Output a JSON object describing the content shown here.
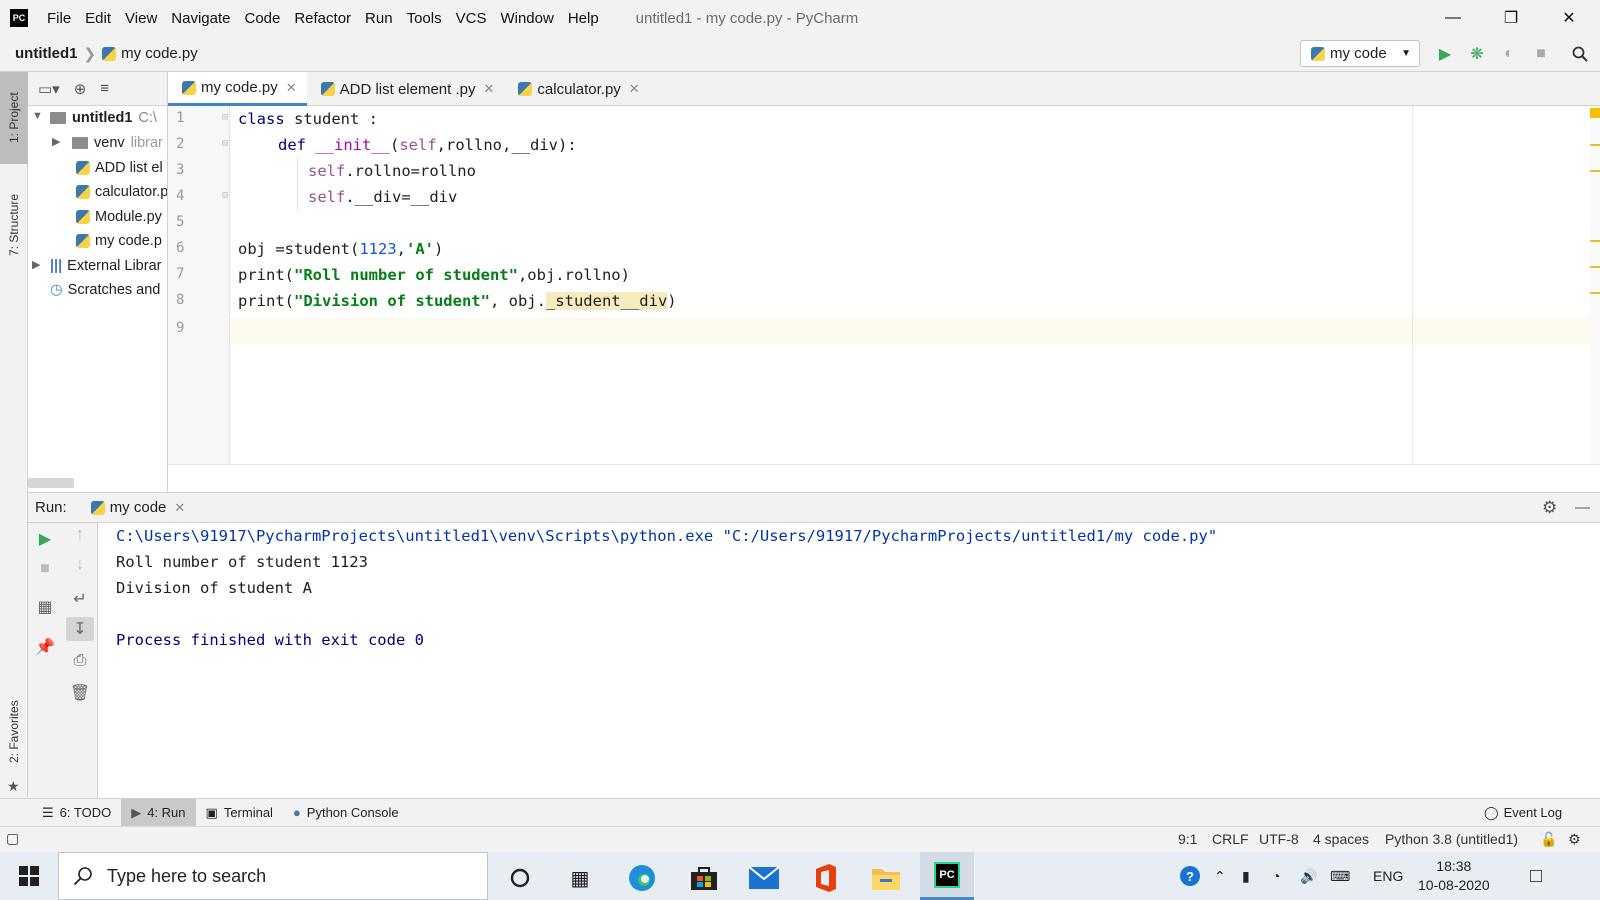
{
  "window": {
    "title": "untitled1 - my code.py - PyCharm",
    "menu": [
      "File",
      "Edit",
      "View",
      "Navigate",
      "Code",
      "Refactor",
      "Run",
      "Tools",
      "VCS",
      "Window",
      "Help"
    ]
  },
  "breadcrumb": {
    "project": "untitled1",
    "file": "my code.py"
  },
  "run_config": {
    "label": "my code"
  },
  "left_stripe": {
    "project": "1: Project",
    "structure": "7: Structure",
    "favorites": "2: Favorites"
  },
  "project_tree": {
    "root": "untitled1",
    "root_path": "C:\\",
    "items": [
      {
        "label": "venv",
        "suffix": "librar"
      },
      {
        "label": "ADD list el"
      },
      {
        "label": "calculator.p"
      },
      {
        "label": "Module.py"
      },
      {
        "label": "my code.p"
      },
      {
        "label": "External Librar"
      },
      {
        "label": "Scratches and"
      }
    ]
  },
  "editor_tabs": [
    {
      "label": "my code.py",
      "active": true
    },
    {
      "label": "ADD list element .py",
      "active": false
    },
    {
      "label": "calculator.py",
      "active": false
    }
  ],
  "code": {
    "line_numbers": [
      "1",
      "2",
      "3",
      "4",
      "5",
      "6",
      "7",
      "8",
      "9"
    ],
    "lines": {
      "l1_kw": "class",
      "l1_rest": " student :",
      "l2_kw": "def",
      "l2_name": " __init__",
      "l2_open": "(",
      "l2_self": "self",
      "l2_rest": ",rollno,__div):",
      "l3_self": "self",
      "l3_rest": ".rollno=rollno",
      "l4_self": "self",
      "l4_rest": ".__div=__div",
      "l6_a": "obj =student(",
      "l6_num": "1123",
      "l6_b": ",",
      "l6_str": "'A'",
      "l6_c": ")",
      "l7_a": "print(",
      "l7_str": "\"Roll number of student\"",
      "l7_b": ",obj.rollno)",
      "l8_a": "print(",
      "l8_str": "\"Division of student\"",
      "l8_b": ", obj.",
      "l8_hl": "_student__div",
      "l8_c": ")"
    }
  },
  "run_panel": {
    "label": "Run:",
    "tab": "my code",
    "output": [
      "C:\\Users\\91917\\PycharmProjects\\untitled1\\venv\\Scripts\\python.exe \"C:/Users/91917/PycharmProjects/untitled1/my code.py\"",
      "Roll number of student 1123",
      "Division of student A",
      "",
      "Process finished with exit code 0"
    ]
  },
  "bottom_tabs": [
    {
      "label": "6: TODO"
    },
    {
      "label": "4: Run",
      "active": true
    },
    {
      "label": "Terminal"
    },
    {
      "label": "Python Console"
    }
  ],
  "event_log": "Event Log",
  "status": {
    "position": "9:1",
    "line_sep": "CRLF",
    "encoding": "UTF-8",
    "indent": "4 spaces",
    "interpreter": "Python 3.8 (untitled1)"
  },
  "taskbar": {
    "search_placeholder": "Type here to search",
    "language": "ENG",
    "time": "18:38",
    "date": "10-08-2020"
  },
  "colors": {
    "keyword": "#000080",
    "string": "#067d17",
    "number": "#1750eb",
    "self": "#94558d",
    "console_path": "#0033b3"
  }
}
